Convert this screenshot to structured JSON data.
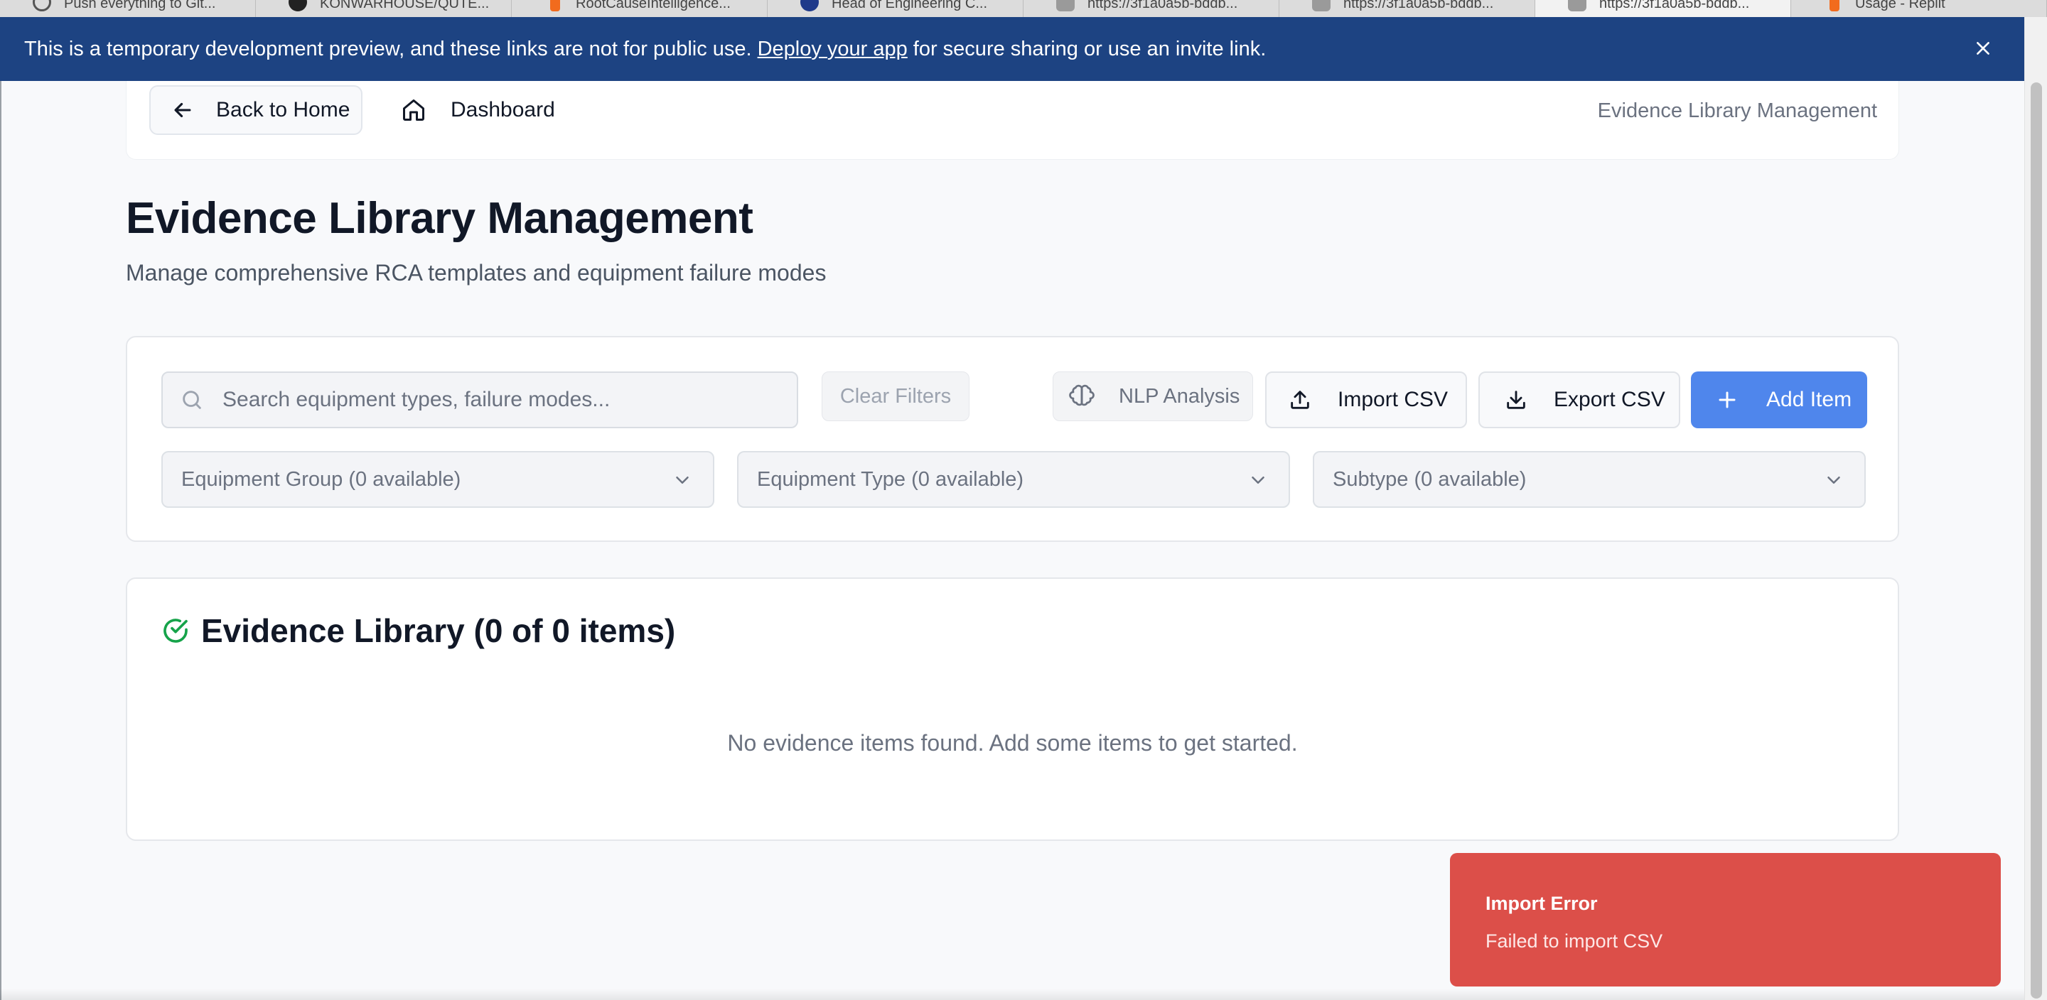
{
  "browser_tabs": [
    {
      "label": "Push everything to Git...",
      "icon": "spinner-icon"
    },
    {
      "label": "KONWARHOUSE/QUTE...",
      "icon": "github-icon"
    },
    {
      "label": "RootCauseIntelligence...",
      "icon": "replit-icon"
    },
    {
      "label": "Head of Engineering C...",
      "icon": "org-logo-icon"
    },
    {
      "label": "https://3f1a0a5b-bddb...",
      "icon": "replit-r-icon"
    },
    {
      "label": "https://3f1a0a5b-bddb...",
      "icon": "replit-r-icon"
    },
    {
      "label": "https://3f1a0a5b-bddb...",
      "icon": "replit-r-icon"
    },
    {
      "label": "Usage - Replit",
      "icon": "replit-icon"
    }
  ],
  "banner": {
    "text_before": "This is a temporary development preview, and these links are not for public use.",
    "link": "Deploy your app",
    "text_after": "for secure sharing or use an invite link.",
    "close_icon": "close-icon"
  },
  "nav": {
    "back_label": "Back to Home",
    "dashboard_label": "Dashboard",
    "breadcrumb_current": "Evidence Library Management"
  },
  "page": {
    "title": "Evidence Library Management",
    "subtitle": "Manage comprehensive RCA templates and equipment failure modes"
  },
  "toolbar": {
    "search_placeholder": "Search equipment types, failure modes...",
    "search_value": "",
    "clear_filters": "Clear Filters",
    "nlp_analysis": "NLP Analysis",
    "import_csv": "Import CSV",
    "export_csv": "Export CSV",
    "add_item": "Add Item"
  },
  "filters": {
    "equipment_group": "Equipment Group (0 available)",
    "equipment_type": "Equipment Type (0 available)",
    "subtype": "Subtype (0 available)"
  },
  "library": {
    "title": "Evidence Library (0 of 0 items)",
    "empty_message": "No evidence items found. Add some items to get started."
  },
  "toast": {
    "title": "Import Error",
    "description": "Failed to import CSV"
  },
  "colors": {
    "banner_bg": "#1d4382",
    "primary": "#4f86ec",
    "toast_error": "#dc4f49",
    "success_icon": "#16a34a"
  }
}
